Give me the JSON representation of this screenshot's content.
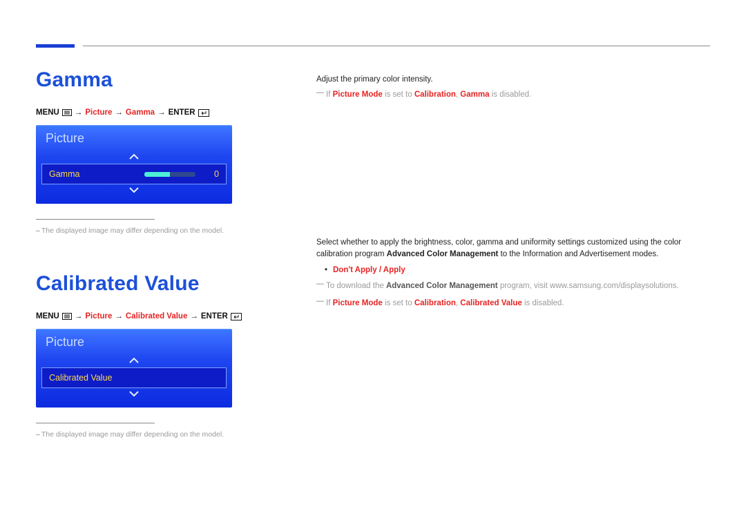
{
  "section1": {
    "title": "Gamma",
    "breadcrumb": {
      "menu": "MENU",
      "picture": "Picture",
      "item": "Gamma",
      "enter": "ENTER"
    },
    "osd": {
      "header": "Picture",
      "row_label": "Gamma",
      "row_value": "0"
    },
    "image_note": "The displayed image may differ depending on the model.",
    "right": {
      "desc": "Adjust the primary color intensity.",
      "note_prefix": "If ",
      "note_pm": "Picture Mode",
      "note_mid": " is set to ",
      "note_cal": "Calibration",
      "note_mid2": ", ",
      "note_item": "Gamma",
      "note_suffix": " is disabled."
    }
  },
  "section2": {
    "title": "Calibrated Value",
    "breadcrumb": {
      "menu": "MENU",
      "picture": "Picture",
      "item": "Calibrated Value",
      "enter": "ENTER"
    },
    "osd": {
      "header": "Picture",
      "row_label": "Calibrated Value"
    },
    "image_note": "The displayed image may differ depending on the model.",
    "right": {
      "desc_a": "Select whether to apply the brightness, color, gamma and uniformity settings customized using the color calibration program ",
      "desc_b_bold": "Advanced Color Management",
      "desc_c": " to the Information and Advertisement modes.",
      "bullet": "Don't Apply / Apply",
      "dl_prefix": "To download the ",
      "dl_bold": "Advanced Color Management",
      "dl_suffix": " program, visit www.samsung.com/displaysolutions.",
      "note2_prefix": "If ",
      "note2_pm": "Picture Mode",
      "note2_mid": " is set to ",
      "note2_cal": "Calibration",
      "note2_mid2": ", ",
      "note2_item": "Calibrated Value",
      "note2_suffix": " is disabled."
    }
  }
}
